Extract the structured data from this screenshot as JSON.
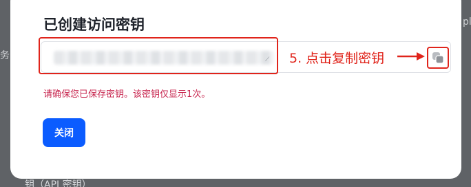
{
  "background": {
    "right_fragment": "ple",
    "left_fragment": "务",
    "bottom_fragment": "钥（API 密钥）"
  },
  "dialog": {
    "title": "已创建访问密钥",
    "access_key_value": "",
    "warning": "请确保您已保存密钥。该密钥仅显示1次。",
    "close_label": "关闭"
  },
  "annotation": {
    "step_text": "5. 点击复制密钥",
    "color": "#e0241b"
  },
  "icons": {
    "copy": "copy-icon",
    "arrow": "arrow-right-icon"
  },
  "colors": {
    "primary": "#0b5cff",
    "warning": "#c7254e",
    "overlay": "#5f6266"
  }
}
